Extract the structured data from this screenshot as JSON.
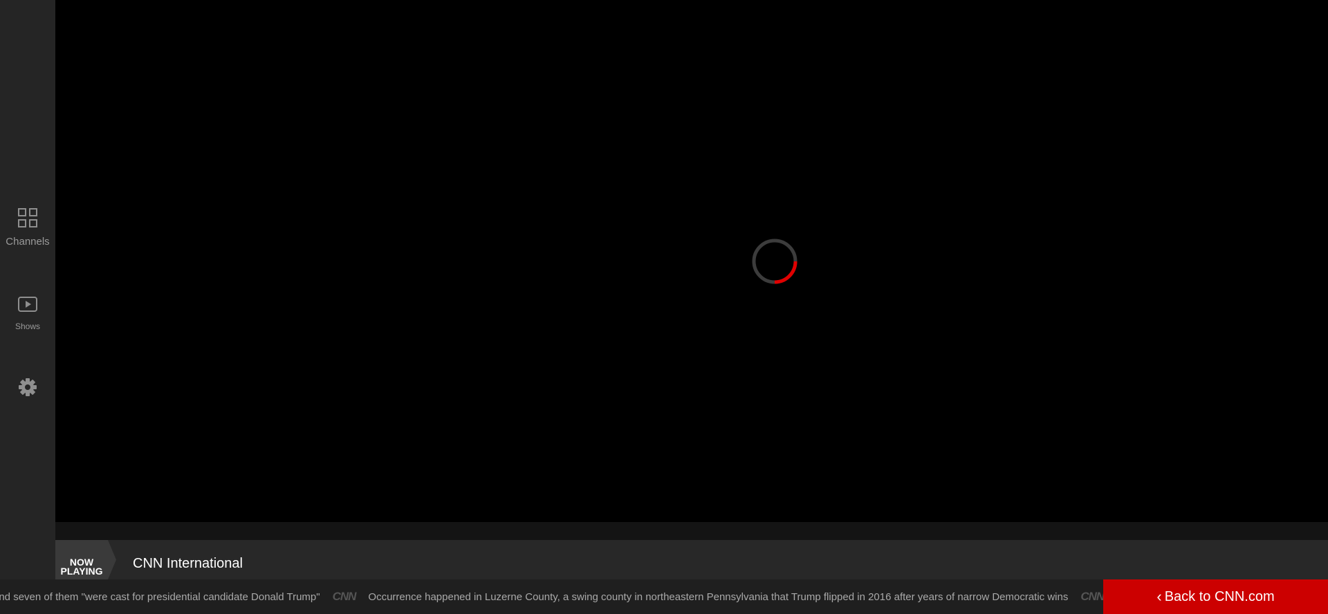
{
  "sidebar": {
    "items": [
      {
        "label": "Channels",
        "icon": "grid-icon"
      },
      {
        "label": "Shows",
        "icon": "play-icon"
      },
      {
        "label": "",
        "icon": "gear-icon"
      }
    ]
  },
  "player": {
    "state": "loading",
    "spinner_color": "#e00000"
  },
  "now_playing": {
    "badge_line1": "NOW",
    "badge_line2": "PLAYING",
    "title": "CNN International"
  },
  "ticker": {
    "logo_text": "CNN",
    "headlines": [
      "and seven of them \"were cast for presidential candidate Donald Trump\"",
      "Occurrence happened in Luzerne County, a swing county in northeastern Pennsylvania that Trump flipped in 2016 after years of narrow Democratic wins"
    ]
  },
  "back_button": {
    "label": "Back to CNN.com",
    "color": "#cc0000"
  }
}
